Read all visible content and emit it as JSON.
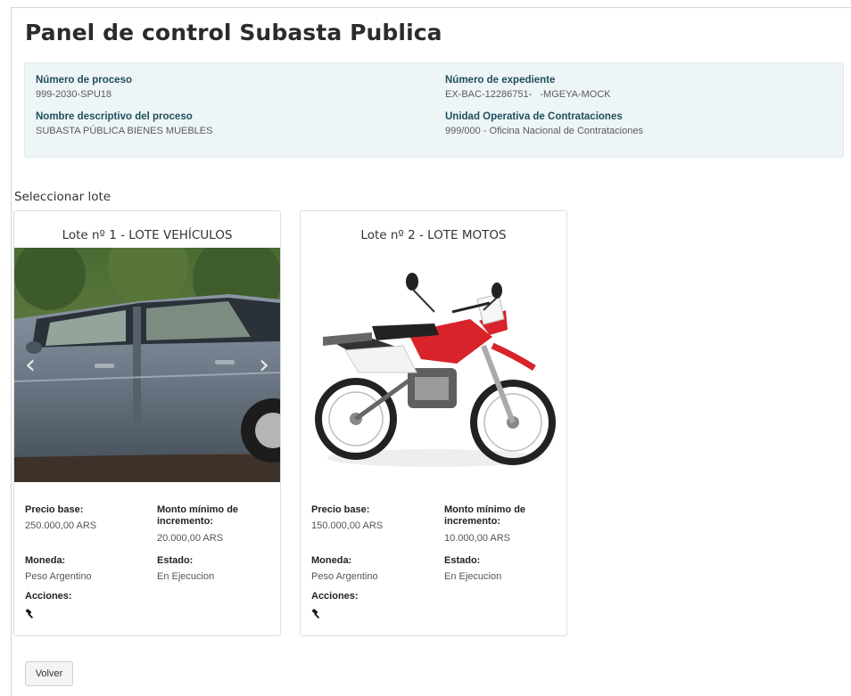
{
  "page": {
    "title": "Panel de control Subasta Publica"
  },
  "info": {
    "process_number": {
      "label": "Número de proceso",
      "value": "999-2030-SPU18"
    },
    "file_number": {
      "label": "Número de expediente",
      "value": "EX-BAC-12286751-   -MGEYA-MOCK"
    },
    "process_name": {
      "label": "Nombre descriptivo del proceso",
      "value": "SUBASTA PÚBLICA BIENES MUEBLES"
    },
    "operating_unit": {
      "label": "Unidad Operativa de Contrataciones",
      "value": "999/000 - Oficina Nacional de Contrataciones"
    }
  },
  "lots_section": {
    "title": "Seleccionar lote"
  },
  "labels": {
    "base_price": "Precio base:",
    "min_increment": "Monto mínimo de incremento:",
    "currency": "Moneda:",
    "status": "Estado:",
    "actions": "Acciones:"
  },
  "lots": [
    {
      "title": "Lote nº 1 - LOTE VEHÍCULOS",
      "base_price": "250.000,00 ARS",
      "min_increment": "20.000,00 ARS",
      "currency": "Peso Argentino",
      "status": "En Ejecucion",
      "carousel": {
        "prev": "‹",
        "next": "›"
      },
      "action_icon": "gavel-icon"
    },
    {
      "title": "Lote nº 2 - LOTE MOTOS",
      "base_price": "150.000,00 ARS",
      "min_increment": "10.000,00 ARS",
      "currency": "Peso Argentino",
      "status": "En Ejecucion",
      "action_icon": "gavel-icon"
    }
  ],
  "footer": {
    "back_button": "Volver"
  },
  "colors": {
    "panel_bg": "#eef5f7",
    "label_teal": "#1f4f5a",
    "moto_red": "#d8232a"
  }
}
